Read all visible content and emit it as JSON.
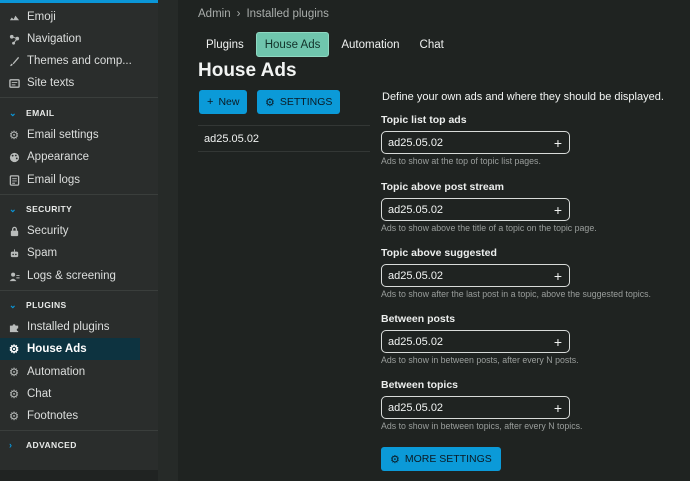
{
  "sidebar": {
    "items_top": [
      {
        "label": "Emoji",
        "icon": "emoji-icon"
      },
      {
        "label": "Navigation",
        "icon": "navigation-icon"
      },
      {
        "label": "Themes and comp...",
        "icon": "paintbrush-icon"
      },
      {
        "label": "Site texts",
        "icon": "text-icon"
      }
    ],
    "email": {
      "heading": "EMAIL",
      "items": [
        {
          "label": "Email settings",
          "icon": "gear-icon"
        },
        {
          "label": "Appearance",
          "icon": "palette-icon"
        },
        {
          "label": "Email logs",
          "icon": "log-icon"
        }
      ]
    },
    "security": {
      "heading": "SECURITY",
      "items": [
        {
          "label": "Security",
          "icon": "lock-icon"
        },
        {
          "label": "Spam",
          "icon": "robot-icon"
        },
        {
          "label": "Logs & screening",
          "icon": "user-log-icon"
        }
      ]
    },
    "plugins": {
      "heading": "PLUGINS",
      "items": [
        {
          "label": "Installed plugins",
          "icon": "puzzle-icon"
        },
        {
          "label": "House Ads",
          "icon": "gear-icon",
          "active": true
        },
        {
          "label": "Automation",
          "icon": "gear-icon"
        },
        {
          "label": "Chat",
          "icon": "gear-icon"
        },
        {
          "label": "Footnotes",
          "icon": "gear-icon"
        }
      ]
    },
    "advanced": {
      "heading": "ADVANCED"
    }
  },
  "breadcrumb": {
    "root": "Admin",
    "separator": "›",
    "current": "Installed plugins"
  },
  "tabs": [
    "Plugins",
    "House Ads",
    "Automation",
    "Chat"
  ],
  "active_tab": "House Ads",
  "page_title": "House Ads",
  "buttons": {
    "new_label": "New",
    "settings_label": "SETTINGS",
    "more_settings_label": "MORE SETTINGS"
  },
  "ads": [
    "ad25.05.02"
  ],
  "settings": {
    "description": "Define your own ads and where they should be displayed.",
    "fields": [
      {
        "label": "Topic list top ads",
        "value": "ad25.05.02",
        "help": "Ads to show at the top of topic list pages."
      },
      {
        "label": "Topic above post stream",
        "value": "ad25.05.02",
        "help": "Ads to show above the title of a topic on the topic page."
      },
      {
        "label": "Topic above suggested",
        "value": "ad25.05.02",
        "help": "Ads to show after the last post in a topic, above the suggested topics."
      },
      {
        "label": "Between posts",
        "value": "ad25.05.02",
        "help": "Ads to show in between posts, after every N posts."
      },
      {
        "label": "Between topics",
        "value": "ad25.05.02",
        "help": "Ads to show in between topics, after every N topics."
      }
    ]
  },
  "colors": {
    "accent": "#0a96d8",
    "active_tab": "#6fc5ad",
    "sidebar_active": "#0d3340"
  }
}
